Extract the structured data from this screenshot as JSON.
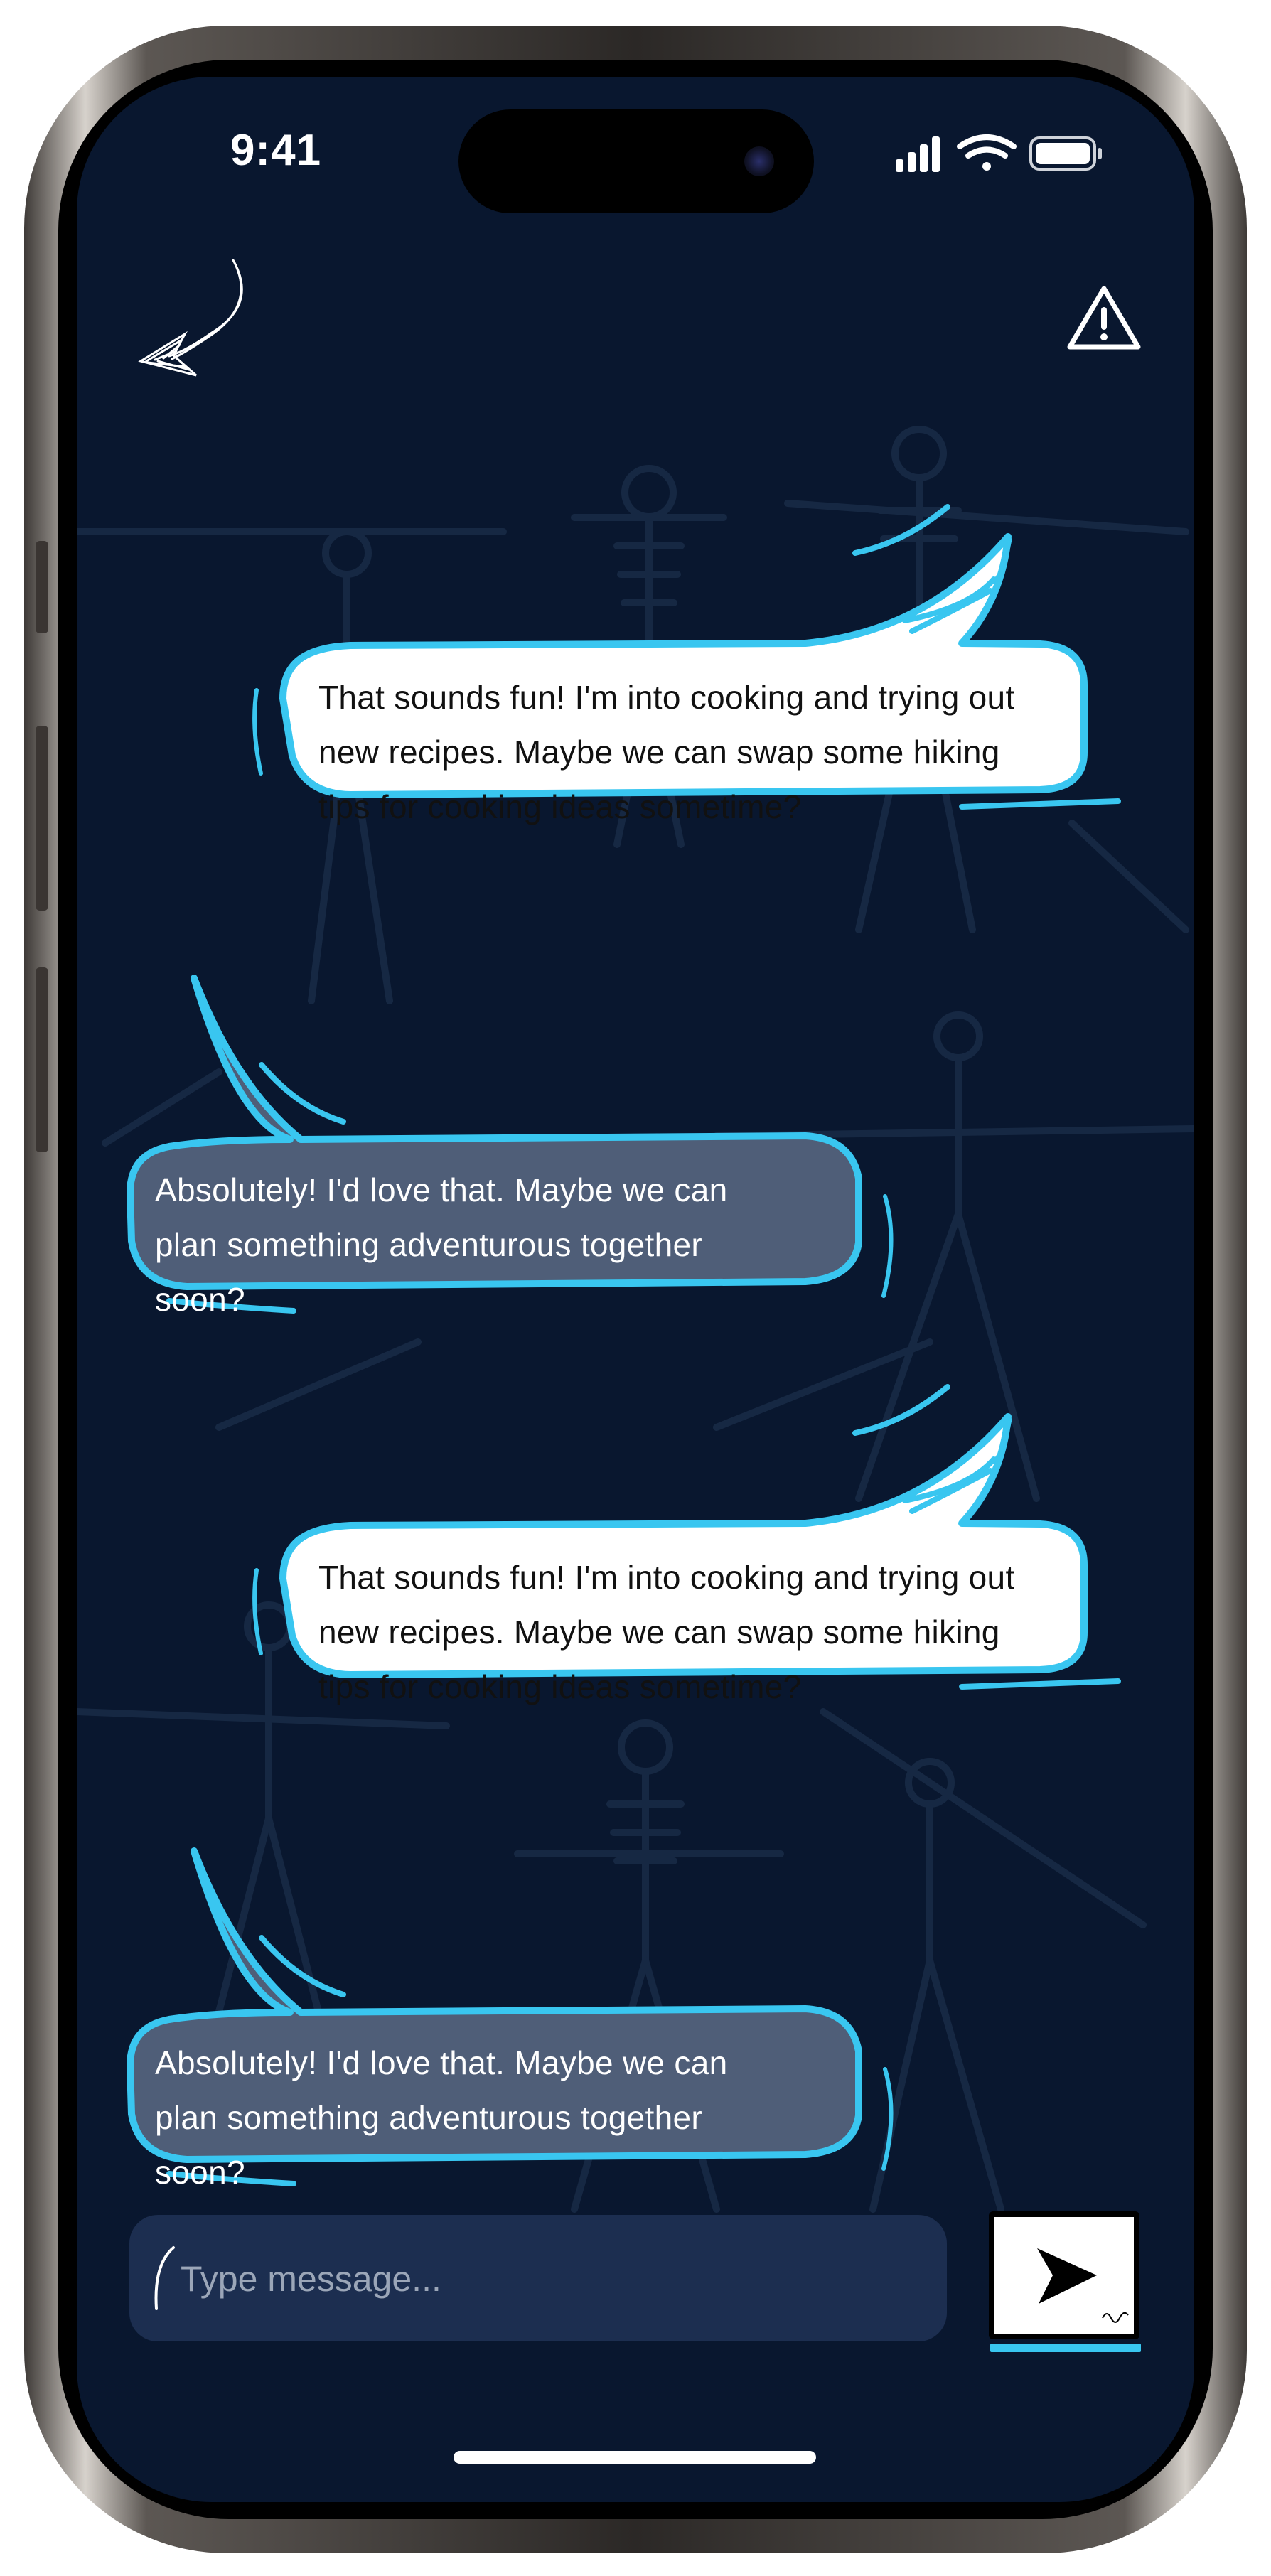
{
  "status_bar": {
    "time": "9:41"
  },
  "header": {
    "back_icon": "hand-drawn-arrow-back-icon",
    "report_icon": "warning-triangle-icon"
  },
  "messages": [
    {
      "direction": "sent",
      "text": "That sounds fun! I'm into cooking and trying out new recipes. Maybe we can swap some hiking tips for cooking ideas sometime?",
      "lines": [
        "That sounds fun! I'm into cooking and trying out",
        "new recipes. Maybe we can swap some hiking",
        "tips for cooking ideas sometime?"
      ]
    },
    {
      "direction": "received",
      "text": "Absolutely! I'd love that. Maybe we can plan something adventurous together soon?",
      "lines": [
        "Absolutely! I'd love that. Maybe we can",
        "plan something adventurous together",
        "soon?"
      ]
    },
    {
      "direction": "sent",
      "text": "That sounds fun! I'm into cooking and trying out new recipes. Maybe we can swap some hiking tips for cooking ideas sometime?",
      "lines": [
        "That sounds fun! I'm into cooking and trying out",
        "new recipes. Maybe we can swap some hiking",
        "tips for cooking ideas sometime?"
      ]
    },
    {
      "direction": "received",
      "text": "Absolutely! I'd love that. Maybe we can plan something adventurous together soon?",
      "lines": [
        "Absolutely! I'd love that. Maybe we can",
        "plan something adventurous together",
        "soon?"
      ]
    }
  ],
  "composer": {
    "placeholder": "Type message...",
    "send_icon": "paper-plane-send-icon"
  },
  "colors": {
    "background": "#09172f",
    "accent": "#39c6f0",
    "sent_bubble": "#ffffff",
    "received_bubble": "#4f5e78",
    "input_bg": "#1c2e50"
  }
}
